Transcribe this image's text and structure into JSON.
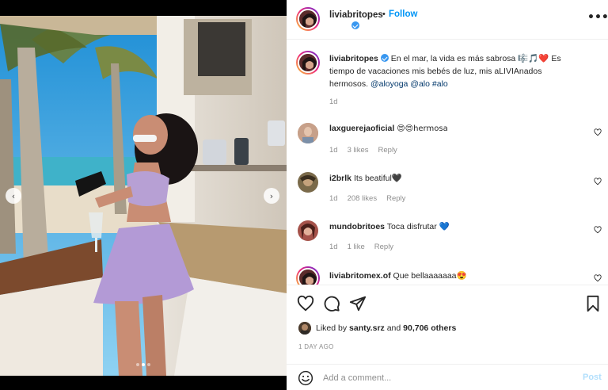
{
  "post": {
    "username": "liviabritopes",
    "follow_label": "Follow",
    "header_dot": "•",
    "more_label": "•••",
    "caption": {
      "username": "liviabritopes",
      "text": "En el mar, la vida es más sabrosa 🎼🎵❤️ Es tiempo de vacaciones mis bebés de luz, mis aLIVIAnados hermosos.",
      "tags": "@aloyoga @alo #alo",
      "time": "1d"
    },
    "carousel": {
      "prev_label": "‹",
      "next_label": "›",
      "slide_count": 3,
      "active_slide": 1
    },
    "comments": [
      {
        "username": "laxguerejaoficial",
        "text": "😍😍hermosa",
        "time": "1d",
        "likes": "3 likes",
        "reply": "Reply"
      },
      {
        "username": "i2brlk",
        "text": "Its beatiful🖤",
        "time": "1d",
        "likes": "208 likes",
        "reply": "Reply"
      },
      {
        "username": "mundobritoes",
        "text": "Toca disfrutar 💙",
        "time": "1d",
        "likes": "1 like",
        "reply": "Reply"
      },
      {
        "username": "liviabritomex.of",
        "text": "Que bellaaaaaaa😍"
      }
    ],
    "likes": {
      "prefix": "Liked by",
      "user": "santy.srz",
      "joiner": "and",
      "count": "90,706 others"
    },
    "timestamp": "1 DAY AGO",
    "comment_box": {
      "placeholder": "Add a comment...",
      "post_label": "Post"
    }
  },
  "colors": {
    "accent": "#0095f6",
    "verified": "#3897f0",
    "muted": "#8e8e8e",
    "text": "#262626"
  },
  "icons": [
    "verified-icon",
    "heart-icon",
    "comment-icon",
    "share-icon",
    "bookmark-icon",
    "emoji-icon",
    "more-icon",
    "chevron-left-icon",
    "chevron-right-icon"
  ]
}
